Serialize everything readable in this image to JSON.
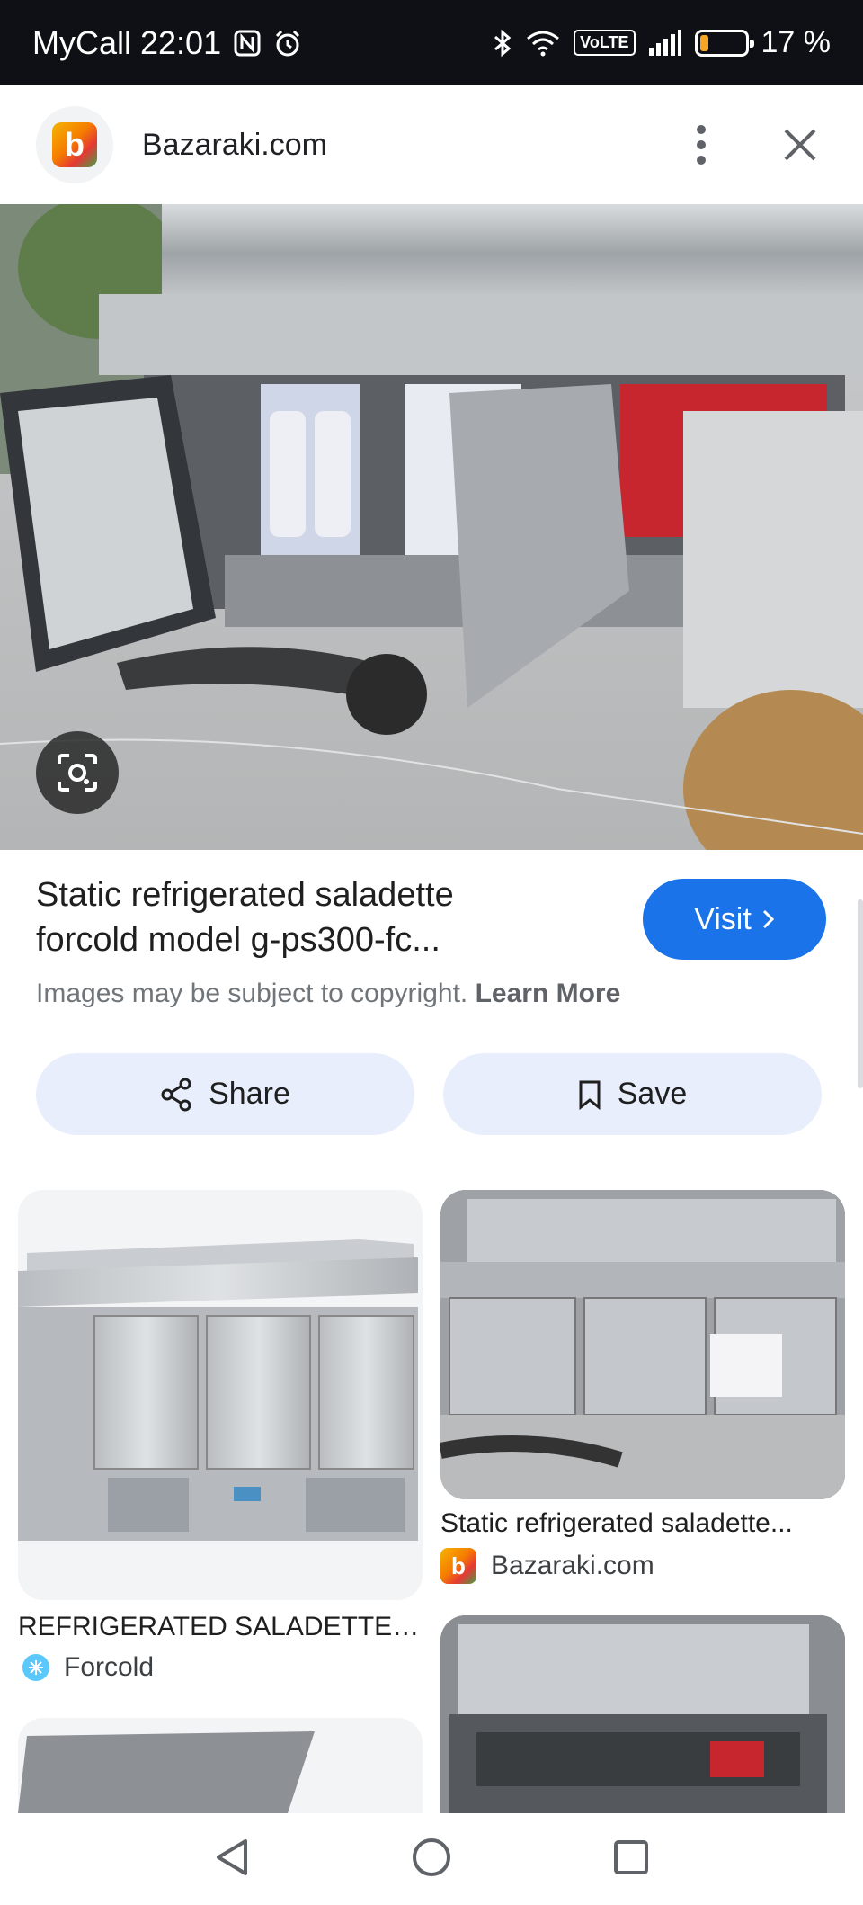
{
  "status_bar": {
    "carrier_time": "MyCall 22:01",
    "battery": "17 %",
    "battery_level": 0.17,
    "volte": "VoLTE"
  },
  "header": {
    "site_name": "Bazaraki.com",
    "logo_letter": "b"
  },
  "result": {
    "title_line1": "Static refrigerated saladette",
    "title_line2": "forcold model g-ps300-fc...",
    "visit_label": "Visit",
    "copyright": "Images may be subject to copyright.",
    "learn_more": "Learn More"
  },
  "actions": {
    "share": "Share",
    "save": "Save"
  },
  "related": [
    {
      "caption": "REFRIGERATED SALADETTES...",
      "source": "Forcold"
    },
    {
      "caption": "Static refrigerated saladette...",
      "source": "Bazaraki.com",
      "logo_letter": "b"
    }
  ],
  "colors": {
    "visit": "#1a73e8",
    "pill_bg": "#e8eefb",
    "status_bg": "#0f1015"
  },
  "icons": [
    "nfc-icon",
    "alarm-icon",
    "bluetooth-icon",
    "wifi-icon",
    "signal-icon",
    "battery-icon",
    "more-vert-icon",
    "close-icon",
    "lens-icon",
    "chevron-right-icon",
    "share-icon",
    "bookmark-icon",
    "back-icon",
    "home-icon",
    "recents-icon"
  ]
}
